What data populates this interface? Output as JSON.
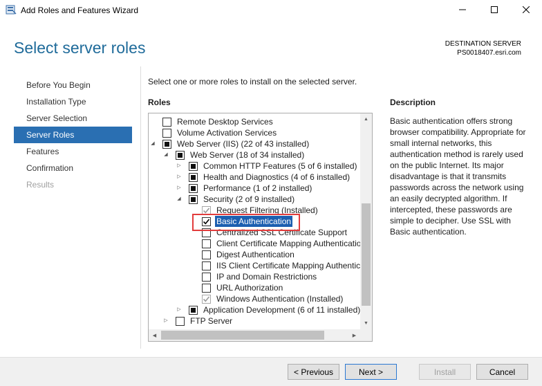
{
  "window": {
    "title": "Add Roles and Features Wizard",
    "icon": "server-manager-icon"
  },
  "header": {
    "page_title": "Select server roles",
    "destination_label": "DESTINATION SERVER",
    "destination_server": "PS0018407.esri.com"
  },
  "nav": {
    "items": [
      {
        "label": "Before You Begin",
        "state": "normal"
      },
      {
        "label": "Installation Type",
        "state": "normal"
      },
      {
        "label": "Server Selection",
        "state": "normal"
      },
      {
        "label": "Server Roles",
        "state": "selected"
      },
      {
        "label": "Features",
        "state": "normal"
      },
      {
        "label": "Confirmation",
        "state": "normal"
      },
      {
        "label": "Results",
        "state": "disabled"
      }
    ]
  },
  "main": {
    "instruction": "Select one or more roles to install on the selected server.",
    "roles_header": "Roles",
    "tree": [
      {
        "label": "Remote Desktop Services",
        "level": 0,
        "expander": "none",
        "check": "unchecked"
      },
      {
        "label": "Volume Activation Services",
        "level": 0,
        "expander": "none",
        "check": "unchecked"
      },
      {
        "label": "Web Server (IIS) (22 of 43 installed)",
        "level": 0,
        "expander": "expanded",
        "check": "partial"
      },
      {
        "label": "Web Server (18 of 34 installed)",
        "level": 1,
        "expander": "expanded",
        "check": "partial"
      },
      {
        "label": "Common HTTP Features (5 of 6 installed)",
        "level": 2,
        "expander": "collapsed",
        "check": "partial"
      },
      {
        "label": "Health and Diagnostics (4 of 6 installed)",
        "level": 2,
        "expander": "collapsed",
        "check": "partial"
      },
      {
        "label": "Performance (1 of 2 installed)",
        "level": 2,
        "expander": "collapsed",
        "check": "partial"
      },
      {
        "label": "Security (2 of 9 installed)",
        "level": 2,
        "expander": "expanded",
        "check": "partial"
      },
      {
        "label": "Request Filtering (Installed)",
        "level": 3,
        "expander": "none",
        "check": "checked-disabled"
      },
      {
        "label": "Basic Authentication",
        "level": 3,
        "expander": "none",
        "check": "checked",
        "selected": true
      },
      {
        "label": "Centralized SSL Certificate Support",
        "level": 3,
        "expander": "none",
        "check": "unchecked"
      },
      {
        "label": "Client Certificate Mapping Authentication",
        "level": 3,
        "expander": "none",
        "check": "unchecked"
      },
      {
        "label": "Digest Authentication",
        "level": 3,
        "expander": "none",
        "check": "unchecked"
      },
      {
        "label": "IIS Client Certificate Mapping Authentication",
        "level": 3,
        "expander": "none",
        "check": "unchecked"
      },
      {
        "label": "IP and Domain Restrictions",
        "level": 3,
        "expander": "none",
        "check": "unchecked"
      },
      {
        "label": "URL Authorization",
        "level": 3,
        "expander": "none",
        "check": "unchecked"
      },
      {
        "label": "Windows Authentication (Installed)",
        "level": 3,
        "expander": "none",
        "check": "checked-disabled"
      },
      {
        "label": "Application Development (6 of 11 installed)",
        "level": 2,
        "expander": "collapsed",
        "check": "partial"
      },
      {
        "label": "FTP Server",
        "level": 1,
        "expander": "collapsed",
        "check": "unchecked"
      }
    ],
    "highlight_color": "#e23c3c"
  },
  "description": {
    "header": "Description",
    "text": "Basic authentication offers strong browser compatibility. Appropriate for small internal networks, this authentication method is rarely used on the public Internet. Its major disadvantage is that it transmits passwords across the network using an easily decrypted algorithm. If intercepted, these passwords are simple to decipher. Use SSL with Basic authentication."
  },
  "buttons": {
    "previous": "< Previous",
    "next": "Next >",
    "install": "Install",
    "cancel": "Cancel"
  },
  "colors": {
    "accent": "#2a6fb2",
    "title": "#1f6b9a",
    "selection": "#1c5fb0"
  }
}
